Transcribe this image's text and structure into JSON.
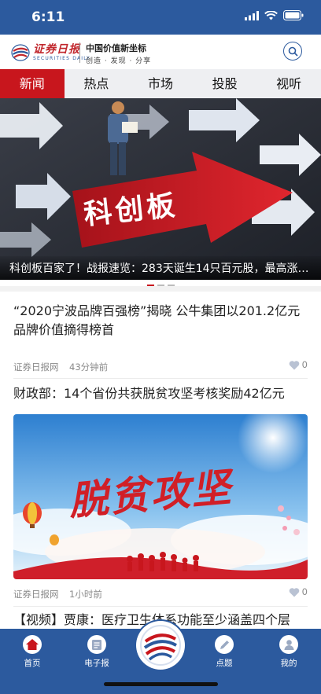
{
  "status_bar": {
    "time": "6:11"
  },
  "header": {
    "logo_cn": "证券日报",
    "logo_en": "SECURITIES DAILY",
    "slogan_line1": "中国价值新坐标",
    "slogan_line2": "创造 · 发现 · 分享"
  },
  "tabs": [
    {
      "label": "新闻",
      "active": true
    },
    {
      "label": "热点",
      "active": false
    },
    {
      "label": "市场",
      "active": false
    },
    {
      "label": "投股",
      "active": false
    },
    {
      "label": "视听",
      "active": false
    }
  ],
  "banner": {
    "image_text": "科创板",
    "caption": "科创板百家了！战报速览：283天诞生14只百元股，最高涨4...",
    "slide_count": 3,
    "active_slide": 1
  },
  "news": [
    {
      "title": "“2020宁波品牌百强榜”揭晓 公牛集团以201.2亿元品牌价值摘得榜首",
      "source": "证券日报网",
      "time": "43分钟前",
      "likes": "0"
    },
    {
      "title": "财政部：14个省份共获脱贫攻坚考核奖励42亿元",
      "image_text": "脱贫攻坚",
      "source": "证券日报网",
      "time": "1小时前",
      "likes": "0"
    },
    {
      "title": "【视频】贾康：医疗卫生体系功能至少涵盖四个层"
    }
  ],
  "bottom_nav": [
    {
      "label": "首页",
      "icon": "home-icon",
      "active": true
    },
    {
      "label": "电子报",
      "icon": "newspaper-icon",
      "active": false
    },
    {
      "label": "",
      "icon": "center-logo-icon",
      "active": false
    },
    {
      "label": "点题",
      "icon": "edit-icon",
      "active": false
    },
    {
      "label": "我的",
      "icon": "user-icon",
      "active": false
    }
  ],
  "colors": {
    "brand_blue": "#2c5a9e",
    "brand_red": "#c8161d"
  }
}
